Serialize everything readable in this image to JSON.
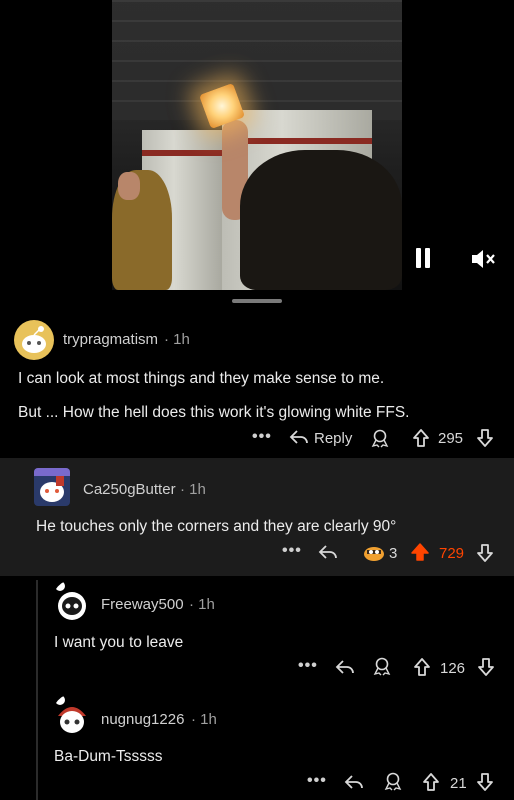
{
  "video": {
    "pause_icon": "pause-icon",
    "mute_icon": "volume-mute-icon"
  },
  "comments": [
    {
      "username": "trypragmatism",
      "time": "· 1h",
      "lines": [
        "I can look at most things and they make sense to me.",
        "But ... How the hell does this work it's glowing white FFS."
      ],
      "reply_label": "Reply",
      "votes": "295"
    },
    {
      "username": "Ca250gButter",
      "time": "· 1h",
      "lines": [
        "He touches only the corners and they are clearly 90°"
      ],
      "award_count": "3",
      "votes": "729",
      "upvoted": true
    },
    {
      "username": "Freeway500",
      "time": "· 1h",
      "lines": [
        "I want you to leave"
      ],
      "votes": "126"
    },
    {
      "username": "nugnug1226",
      "time": "· 1h",
      "lines": [
        "Ba-Dum-Tsssss"
      ],
      "votes": "21"
    }
  ],
  "colors": {
    "upvote_active": "#ff4500",
    "background": "#000000",
    "highlight": "#1c1c1c"
  }
}
